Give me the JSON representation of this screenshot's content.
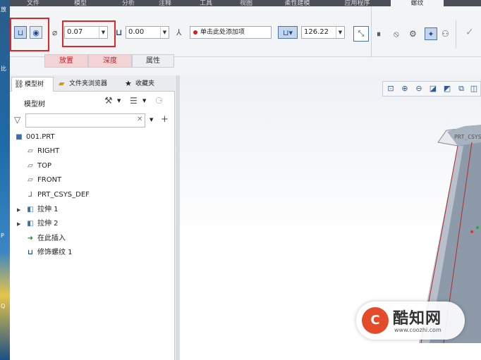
{
  "desktop": {
    "glyphs": [
      "放",
      "比",
      "P",
      "Q"
    ]
  },
  "ribbon": {
    "tabs": [
      "文件",
      "模型",
      "分析",
      "注释",
      "工具",
      "视图",
      "柔性建模",
      "应用程序",
      "螺纹"
    ],
    "active_tab": "螺纹"
  },
  "dashboard": {
    "diameter_value": "0.07",
    "depth_value": "0.00",
    "reference_placeholder": "单击此处添加项",
    "depth_length_value": "126.22",
    "subtabs": [
      "放置",
      "深度",
      "属性"
    ]
  },
  "navigator": {
    "tabs": [
      "模型树",
      "文件夹浏览器",
      "收藏夹"
    ],
    "tree_title": "模型树",
    "search_placeholder": "",
    "items": [
      {
        "label": "001.PRT",
        "icon": "part-icon"
      },
      {
        "label": "RIGHT",
        "icon": "datum-plane-icon"
      },
      {
        "label": "TOP",
        "icon": "datum-plane-icon"
      },
      {
        "label": "FRONT",
        "icon": "datum-plane-icon"
      },
      {
        "label": "PRT_CSYS_DEF",
        "icon": "csys-icon"
      },
      {
        "label": "拉伸 1",
        "icon": "extrude-icon"
      },
      {
        "label": "拉伸 2",
        "icon": "extrude-icon"
      },
      {
        "label": "在此插入",
        "icon": "insert-here-icon"
      },
      {
        "label": "修饰螺纹 1",
        "icon": "cosmetic-thread-icon"
      }
    ]
  },
  "graphics": {
    "csys_label": "PRT_CSYS"
  },
  "watermark": {
    "logo_text": "C",
    "name": "酷知网",
    "url": "www.coozhi.com"
  },
  "colors": {
    "highlight": "#e0262b",
    "subtab_active": "#c21e28",
    "model": "#8d9aaa"
  }
}
